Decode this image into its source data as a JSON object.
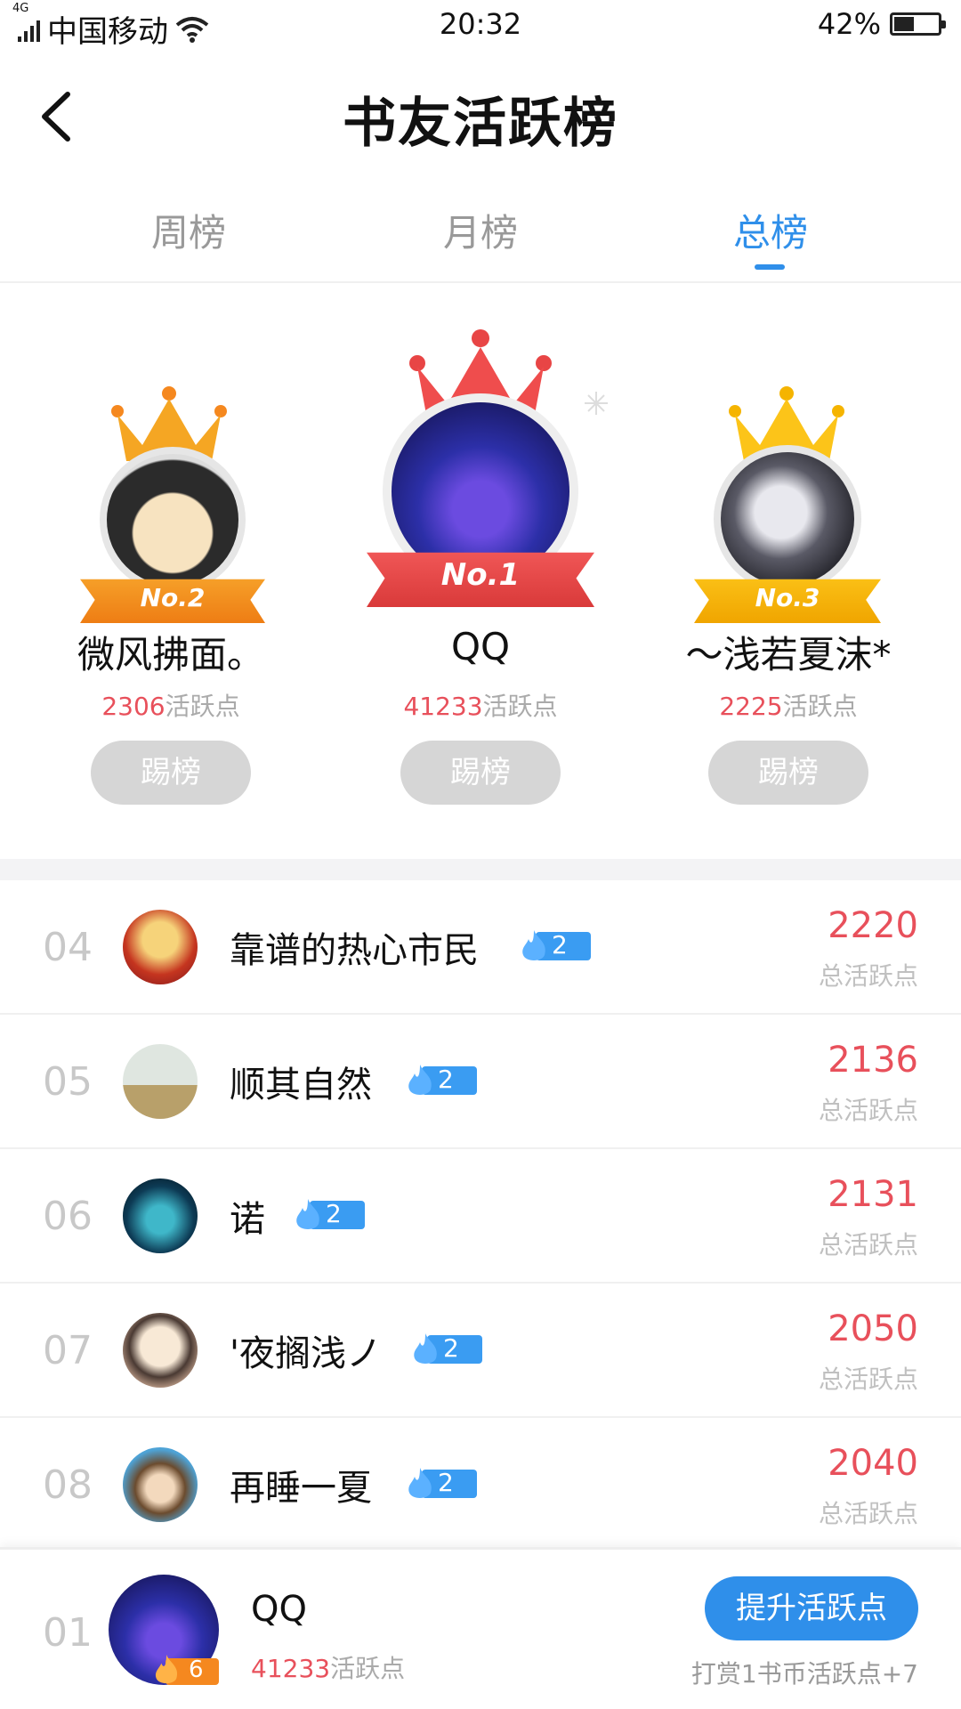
{
  "status_bar": {
    "network": "4G",
    "carrier": "中国移动",
    "time": "20:32",
    "battery": "42%"
  },
  "header": {
    "title": "书友活跃榜"
  },
  "tabs": [
    {
      "label": "周榜",
      "active": false
    },
    {
      "label": "月榜",
      "active": false
    },
    {
      "label": "总榜",
      "active": true
    }
  ],
  "podium": [
    {
      "rank_label": "No.2",
      "name": "微风拂面。",
      "score": "2306",
      "score_unit": "活跃点",
      "kick_label": "踢榜"
    },
    {
      "rank_label": "No.1",
      "name": "QQ",
      "score": "41233",
      "score_unit": "活跃点",
      "kick_label": "踢榜"
    },
    {
      "rank_label": "No.3",
      "name": "～浅若夏沫*",
      "score": "2225",
      "score_unit": "活跃点",
      "kick_label": "踢榜"
    }
  ],
  "list": [
    {
      "rank": "04",
      "name": "靠谱的热心市民",
      "level": "2",
      "score": "2220",
      "score_label": "总活跃点"
    },
    {
      "rank": "05",
      "name": "顺其自然",
      "level": "2",
      "score": "2136",
      "score_label": "总活跃点"
    },
    {
      "rank": "06",
      "name": "诺",
      "level": "2",
      "score": "2131",
      "score_label": "总活跃点"
    },
    {
      "rank": "07",
      "name": "'夜搁浅ノ",
      "level": "2",
      "score": "2050",
      "score_label": "总活跃点"
    },
    {
      "rank": "08",
      "name": "再睡一夏",
      "level": "2",
      "score": "2040",
      "score_label": "总活跃点"
    }
  ],
  "footer": {
    "rank": "01",
    "name": "QQ",
    "level": "6",
    "score": "41233",
    "score_unit": "活跃点",
    "boost_label": "提升活跃点",
    "tip": "打赏1书币活跃点+7"
  },
  "colors": {
    "accent": "#2f8fea",
    "score_red": "#e8505b",
    "gold": "#f5b400",
    "orange": "#f5881f",
    "red": "#e84545"
  }
}
